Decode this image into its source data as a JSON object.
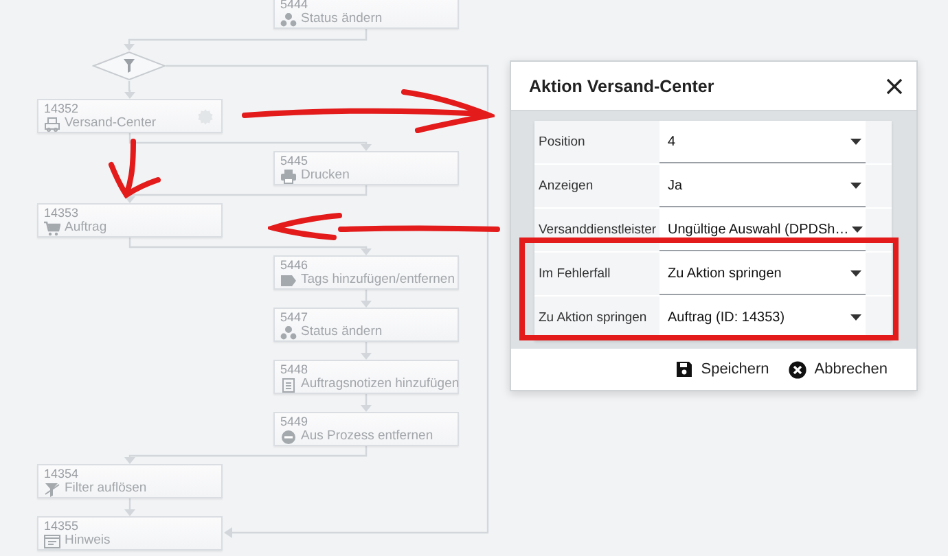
{
  "flow": [
    {
      "kind": "action",
      "id": "5444",
      "label": "Status ändern",
      "gear": false
    },
    {
      "kind": "filter"
    },
    {
      "kind": "action",
      "id": "14352",
      "label": "Versand-Center",
      "gear": true
    },
    {
      "kind": "action",
      "id": "5445",
      "label": "Drucken",
      "gear": false
    },
    {
      "kind": "action",
      "id": "14353",
      "label": "Auftrag",
      "gear": false
    },
    {
      "kind": "action",
      "id": "5446",
      "label": "Tags hinzufügen/entfernen",
      "gear": false
    },
    {
      "kind": "action",
      "id": "5447",
      "label": "Status ändern",
      "gear": false
    },
    {
      "kind": "action",
      "id": "5448",
      "label": "Auftragsnotizen hinzufügen",
      "gear": false
    },
    {
      "kind": "action",
      "id": "5449",
      "label": "Aus Prozess entfernen",
      "gear": false
    },
    {
      "kind": "action",
      "id": "14354",
      "label": "Filter auflösen",
      "gear": false
    },
    {
      "kind": "action",
      "id": "14355",
      "label": "Hinweis",
      "gear": false
    }
  ],
  "dialog": {
    "title": "Aktion Versand-Center",
    "fields": [
      {
        "label": "Position",
        "value": "4"
      },
      {
        "label": "Anzeigen",
        "value": "Ja"
      },
      {
        "label": "Versanddienstleister",
        "value": "Ungültige Auswahl (DPDSh…"
      },
      {
        "label": "Im Fehlerfall",
        "value": "Zu Aktion springen"
      },
      {
        "label": "Zu Aktion springen",
        "value": "Auftrag (ID: 14353)"
      }
    ],
    "buttons": [
      {
        "label": "Speichern",
        "kind": "save"
      },
      {
        "label": "Abbrechen",
        "kind": "cancel"
      }
    ]
  }
}
